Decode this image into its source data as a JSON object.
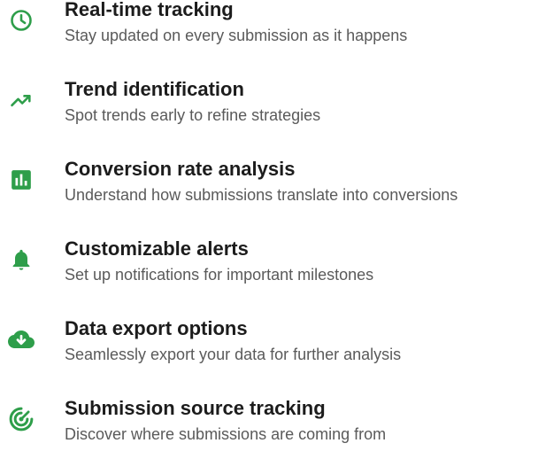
{
  "theme": {
    "accent": "#2e9e4a"
  },
  "features": [
    {
      "icon": "clock-icon",
      "title": "Real-time tracking",
      "description": "Stay updated on every submission as it happens"
    },
    {
      "icon": "trending-up-icon",
      "title": "Trend identification",
      "description": "Spot trends early to refine strategies"
    },
    {
      "icon": "bar-chart-icon",
      "title": "Conversion rate analysis",
      "description": "Understand how submissions translate into conversions"
    },
    {
      "icon": "bell-icon",
      "title": "Customizable alerts",
      "description": "Set up notifications for important milestones"
    },
    {
      "icon": "cloud-download-icon",
      "title": "Data export options",
      "description": "Seamlessly export your data for further analysis"
    },
    {
      "icon": "source-target-icon",
      "title": "Submission source tracking",
      "description": "Discover where submissions are coming from"
    }
  ]
}
